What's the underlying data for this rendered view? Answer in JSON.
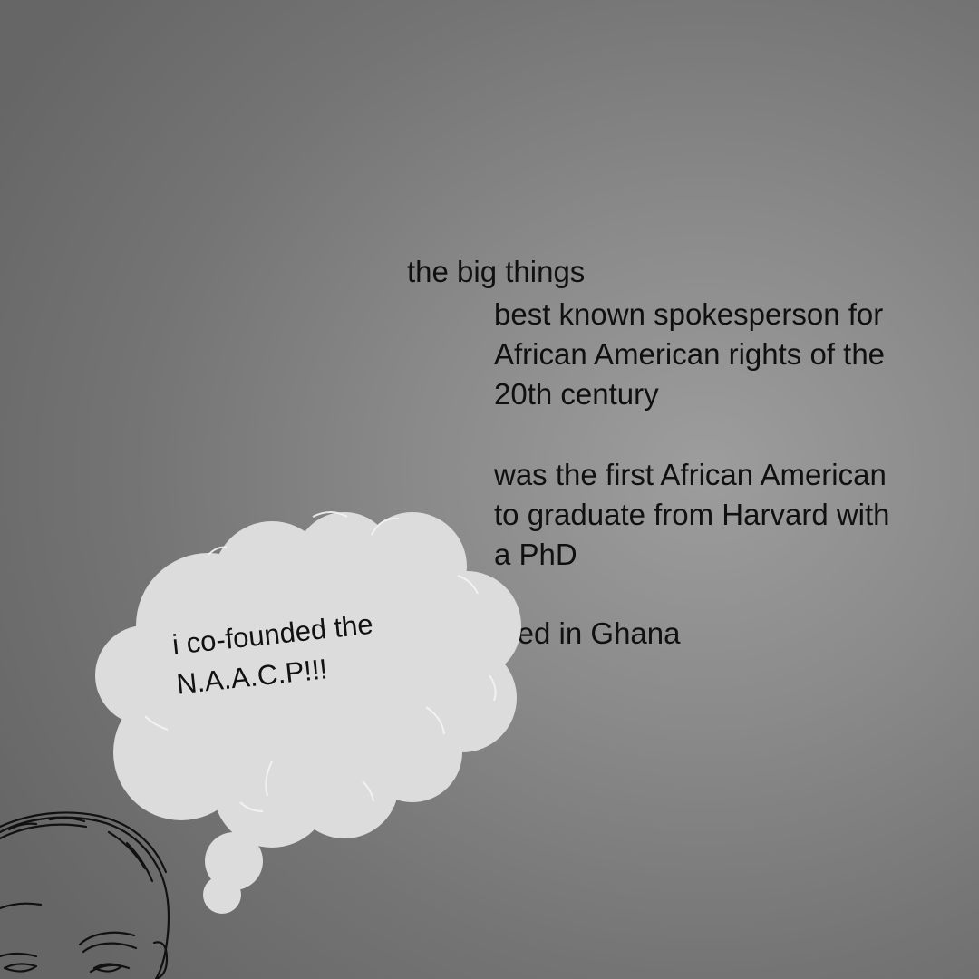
{
  "slide": {
    "heading": "the big things",
    "facts": [
      {
        "lines": [
          "best known spokesperson for",
          "African American rights of the",
          "20th century"
        ]
      },
      {
        "lines": [
          "was the first African American",
          "to graduate from Harvard with",
          "a PhD"
        ]
      },
      {
        "lines": [
          "died in Ghana"
        ]
      }
    ],
    "thought_bubble": {
      "lines": [
        "i co-founded the",
        "N.A.A.C.P!!!"
      ],
      "fill_color": "#dcdcdc"
    },
    "portrait": {
      "icon": "line-drawing-portrait"
    },
    "colors": {
      "background_center": "#9d9d9d",
      "background_edge": "#666666",
      "text": "#101010"
    }
  }
}
